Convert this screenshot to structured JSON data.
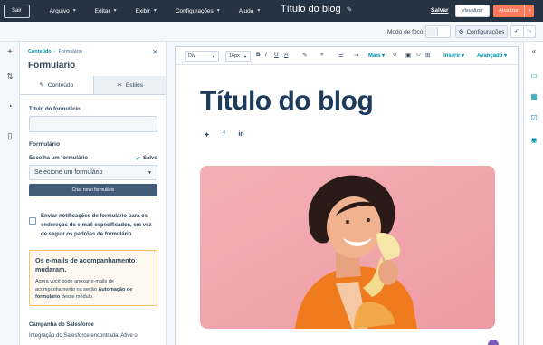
{
  "topbar": {
    "exit_label": "Sair",
    "menus": [
      {
        "label": "Arquivo"
      },
      {
        "label": "Editar"
      },
      {
        "label": "Exibir"
      },
      {
        "label": "Configurações"
      },
      {
        "label": "Ajuda"
      }
    ],
    "doc_title": "Título do blog",
    "save_label": "Salvar",
    "preview_label": "Visualizar",
    "update_label": "Atualizar"
  },
  "secondary": {
    "focus_mode_label": "Modo de foco",
    "settings_label": "Configurações"
  },
  "panel": {
    "breadcrumb_root": "Conteúdo",
    "breadcrumb_current": "Formulário",
    "title": "Formulário",
    "tabs": [
      {
        "label": "Conteúdo"
      },
      {
        "label": "Estilos"
      }
    ],
    "form_title_label": "Título do formulário",
    "form_title_value": "",
    "section_label": "Formulário",
    "choose_label": "Escolha um formulário",
    "saved_label": "Salvo",
    "select_value": "Selecione um formulário",
    "create_button": "Criar novo formulário",
    "notify_text": "Enviar notificações de formulário para os endereços de e-mail especificados, em vez de seguir os padrões de formulário",
    "callout_title": "Os e-mails de acompanhamento mudaram.",
    "callout_body_1": "Agora você pode anexar e-mails de acompanhamento na seção ",
    "callout_body_bold": "Automação de formulário",
    "callout_body_2": " desse módulo.",
    "salesforce_label": "Campanha do Salesforce",
    "salesforce_text": "Integração do Salesforce encontrada. Ative o"
  },
  "toolbar": {
    "block_select": "Div",
    "size_select": "16px",
    "more_label": "Mais",
    "insert_label": "Inserir",
    "advanced_label": "Avançado"
  },
  "canvas": {
    "blog_title": "Título do blog"
  },
  "colors": {
    "topbar": "#253342",
    "accent_orange": "#ff7a59",
    "link_teal": "#0091ae",
    "title_navy": "#1d3b5c",
    "photo_bg": "#f2a6ae"
  }
}
